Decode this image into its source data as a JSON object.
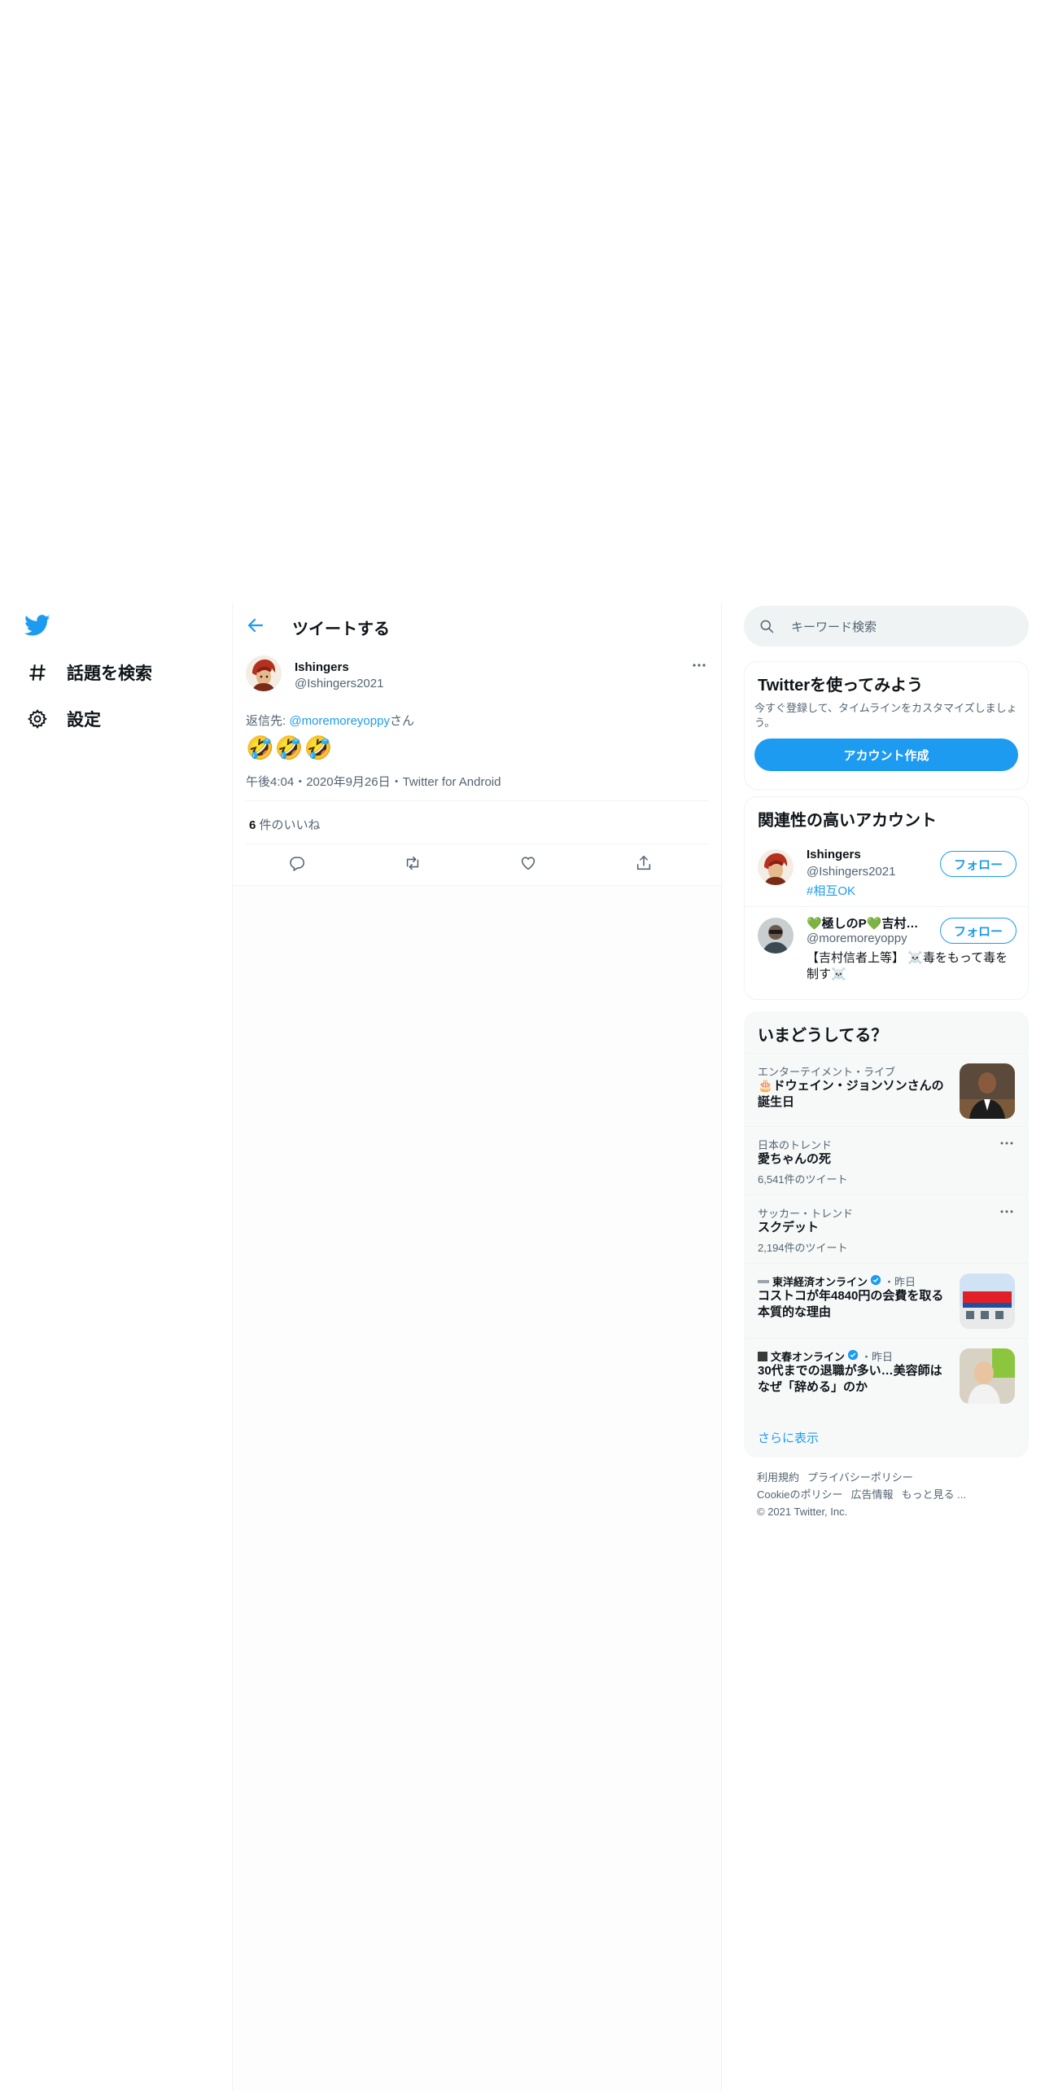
{
  "nav": {
    "items": [
      {
        "label": "話題を検索"
      },
      {
        "label": "設定"
      }
    ]
  },
  "header": {
    "title": "ツイートする"
  },
  "tweet": {
    "name": "Ishingers",
    "handle": "@Ishingers2021",
    "reply_prefix": "返信先: ",
    "reply_user": "@moremoreyoppy",
    "reply_suffix": "さん",
    "text": "🤣🤣🤣",
    "meta": "午後4:04・2020年9月26日・Twitter for Android",
    "likes_count": "6",
    "likes_label": " 件のいいね"
  },
  "search": {
    "placeholder": "キーワード検索"
  },
  "signup": {
    "title": "Twitterを使ってみよう",
    "desc": "今すぐ登録して、タイムラインをカスタマイズしましょう。",
    "button": "アカウント作成"
  },
  "related": {
    "title": "関連性の高いアカウント",
    "follow_label": "フォロー",
    "accounts": [
      {
        "name": "Ishingers",
        "handle": "@Ishingers2021",
        "bio": "#相互OK"
      },
      {
        "name": "💚極しのP💚吉村信者上等",
        "handle": "@moremoreyoppy",
        "bio": "【吉村信者上等】 ☠️毒をもって毒を制す☠️"
      }
    ]
  },
  "trends": {
    "title": "いまどうしてる？",
    "items": [
      {
        "context": "エンターテイメント・ライブ",
        "title": "🎂ドウェイン・ジョンソンさんの誕生日"
      },
      {
        "context": "日本のトレンド",
        "title": "愛ちゃんの死",
        "count": "6,541件のツイート"
      },
      {
        "context": "サッカー・トレンド",
        "title": "スクデット",
        "count": "2,194件のツイート"
      },
      {
        "source": "東洋経済オンライン",
        "time": "・昨日",
        "title": "コストコが年4840円の会費を取る本質的な理由"
      },
      {
        "source": "文春オンライン",
        "time": "・昨日",
        "title": "30代までの退職が多い…美容師はなぜ「辞める」のか"
      }
    ],
    "show_more": "さらに表示"
  },
  "footer": {
    "links": [
      "利用規約",
      "プライバシーポリシー",
      "Cookieのポリシー",
      "広告情報",
      "もっと見る ..."
    ],
    "copyright": "© 2021 Twitter, Inc."
  },
  "colors": {
    "accent": "#1d9bf0",
    "muted": "#536471",
    "border": "#eff3f4"
  }
}
